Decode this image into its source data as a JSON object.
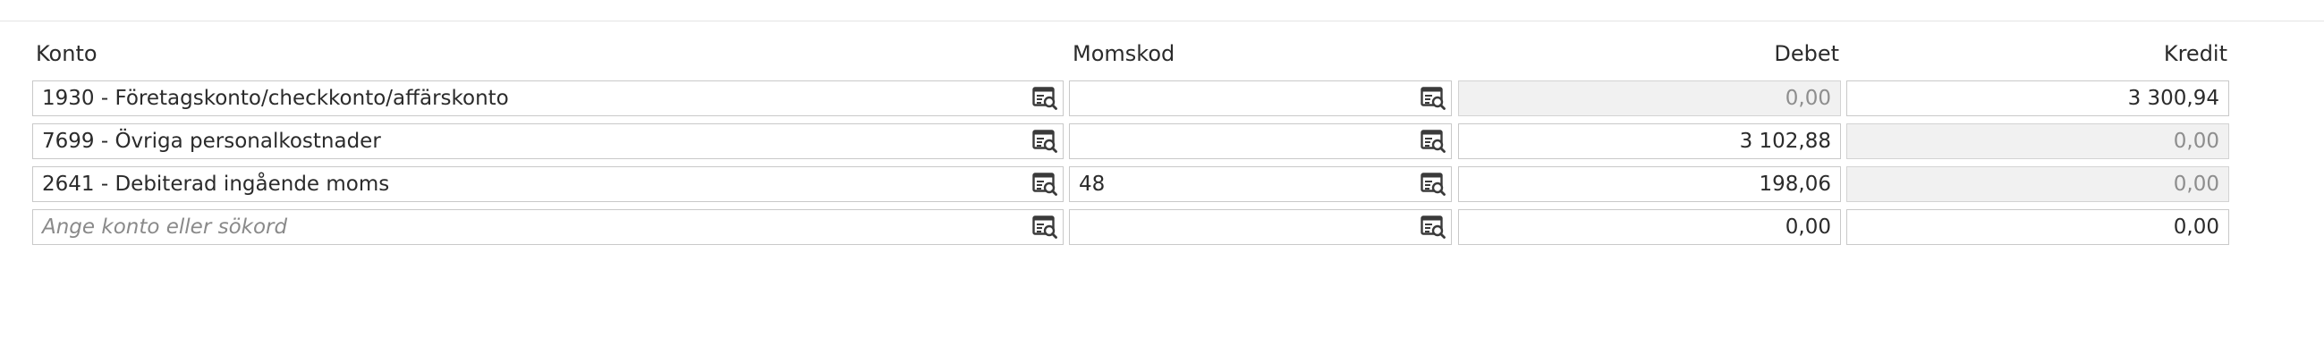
{
  "columns": {
    "konto": "Konto",
    "momskod": "Momskod",
    "debet": "Debet",
    "kredit": "Kredit"
  },
  "rows": [
    {
      "konto": "1930 - Företagskonto/checkkonto/affärskonto",
      "momskod": "",
      "debet": "0,00",
      "kredit": "3 300,94",
      "debet_disabled": true,
      "kredit_disabled": false
    },
    {
      "konto": "7699 - Övriga personalkostnader",
      "momskod": "",
      "debet": "3 102,88",
      "kredit": "0,00",
      "debet_disabled": false,
      "kredit_disabled": true
    },
    {
      "konto": "2641 - Debiterad ingående moms",
      "momskod": "48",
      "debet": "198,06",
      "kredit": "0,00",
      "debet_disabled": false,
      "kredit_disabled": true
    }
  ],
  "new_row": {
    "konto_placeholder": "Ange konto eller sökord",
    "debet": "0,00",
    "kredit": "0,00"
  },
  "icons": {
    "lookup": "list-search-icon"
  }
}
